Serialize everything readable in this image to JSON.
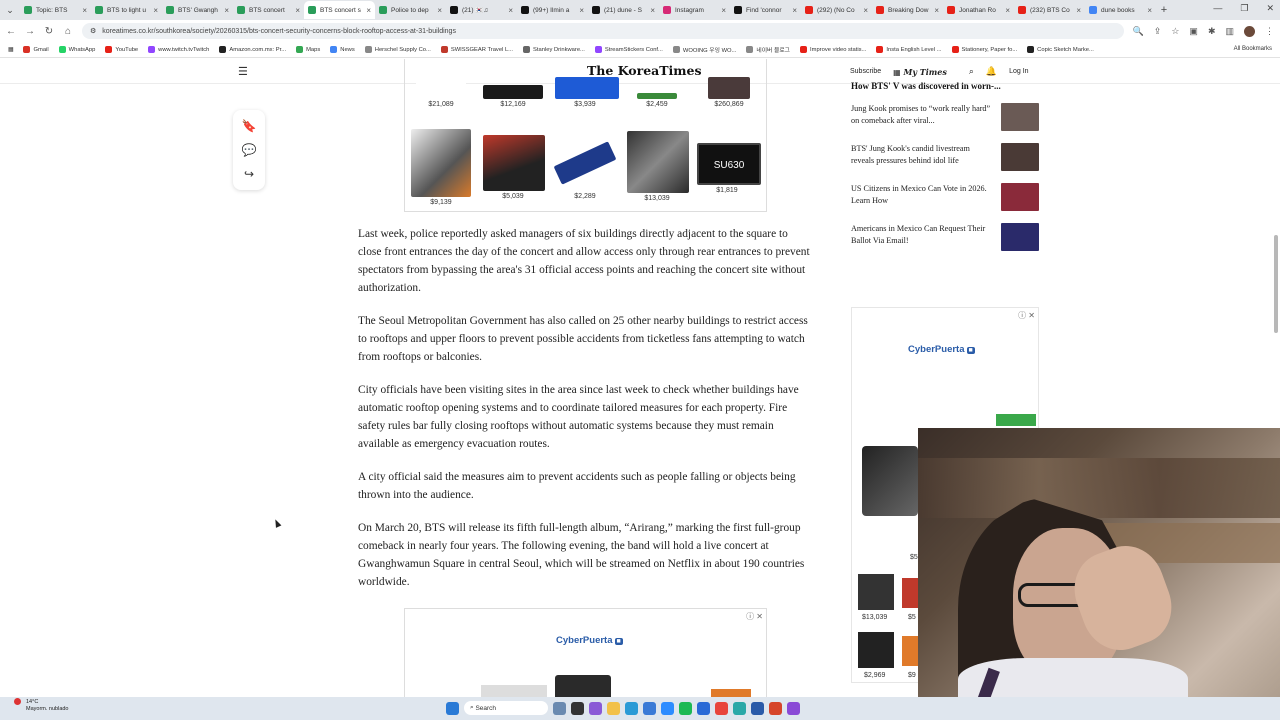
{
  "tabs": [
    {
      "label": "Topic: BTS",
      "color": "#2a9d5a",
      "active": false
    },
    {
      "label": "BTS to light u",
      "color": "#2a9d5a",
      "active": false
    },
    {
      "label": "BTS' Gwangh",
      "color": "#2a9d5a",
      "active": false
    },
    {
      "label": "BTS concert",
      "color": "#2a9d5a",
      "active": false
    },
    {
      "label": "BTS concert s",
      "color": "#2a9d5a",
      "active": true
    },
    {
      "label": "Police to dep",
      "color": "#2a9d5a",
      "active": false
    },
    {
      "label": "(21) 🇰🇷♫",
      "color": "#111111",
      "active": false
    },
    {
      "label": "(99+) Ilmin a",
      "color": "#111111",
      "active": false
    },
    {
      "label": "(21) dune - S",
      "color": "#111111",
      "active": false
    },
    {
      "label": "Instagram",
      "color": "#d62976",
      "active": false
    },
    {
      "label": "Find 'connor",
      "color": "#111111",
      "active": false
    },
    {
      "label": "(292) (No Co",
      "color": "#e62117",
      "active": false
    },
    {
      "label": "Breaking Dow",
      "color": "#e62117",
      "active": false
    },
    {
      "label": "Jonathan Ro",
      "color": "#e62117",
      "active": false
    },
    {
      "label": "(232) BTS Co",
      "color": "#e62117",
      "active": false
    },
    {
      "label": "dune books",
      "color": "#4285f4",
      "active": false
    }
  ],
  "address": {
    "url": "koreatimes.co.kr/southkorea/society/20260315/bts-concert-security-concerns-block-rooftop-access-at-31-buildings"
  },
  "bookmarks": [
    {
      "label": "Gmail",
      "color": "#d93025"
    },
    {
      "label": "WhatsApp",
      "color": "#25d366"
    },
    {
      "label": "YouTube",
      "color": "#e62117"
    },
    {
      "label": "www.twitch.tvTwitch",
      "color": "#9146ff"
    },
    {
      "label": "Amazon.com.mx: Pr...",
      "color": "#222222"
    },
    {
      "label": "Maps",
      "color": "#34a853"
    },
    {
      "label": "News",
      "color": "#4285f4"
    },
    {
      "label": "Herschel Supply Co...",
      "color": "#888888"
    },
    {
      "label": "SWISSGEAR Travel L...",
      "color": "#c0392b"
    },
    {
      "label": "Stanley Drinkware...",
      "color": "#666666"
    },
    {
      "label": "StreamStickers Conf...",
      "color": "#9146ff"
    },
    {
      "label": "WOOING 우잉 WO...",
      "color": "#888888"
    },
    {
      "label": "네이버 블로그",
      "color": "#888888"
    },
    {
      "label": "Improve video statis...",
      "color": "#e62117"
    },
    {
      "label": "Insta English Level ...",
      "color": "#e62117"
    },
    {
      "label": "Stationery, Paper fo...",
      "color": "#e62117"
    },
    {
      "label": "Copic Sketch Marke...",
      "color": "#222222"
    }
  ],
  "bookmarks_all": "All Bookmarks",
  "site": {
    "logo": "The KoreaTimes",
    "subscribe": "Subscribe",
    "mytimes": "My Times",
    "login": "Log In"
  },
  "ad_top": {
    "row1": [
      "$21,089",
      "$12,169",
      "$3,939",
      "$2,459",
      "$260,869"
    ],
    "row2": [
      "$9,139",
      "$5,039",
      "$2,289",
      "$13,039",
      "$1,819"
    ],
    "ssd_label": "SU630"
  },
  "article": {
    "paragraphs": [
      "Last week, police reportedly asked managers of six buildings directly adjacent to the square to close front entrances the day of the concert and allow access only through rear entrances to prevent spectators from bypassing the area's 31 official access points and reaching the concert site without authorization.",
      "The Seoul Metropolitan Government has also called on 25 other nearby buildings to restrict access to rooftops and upper floors to prevent possible accidents from ticketless fans attempting to watch from rooftops or balconies.",
      "City officials have been visiting sites in the area since last week to check whether buildings have automatic rooftop opening systems and to coordinate tailored measures for each property. Fire safety rules bar fully closing rooftops without automatic systems because they must remain available as emergency evacuation routes.",
      "A city official said the measures aim to prevent accidents such as people falling or objects being thrown into the audience.",
      "On March 20, BTS will release its fifth full-length album, “Arirang,” marking the first full-group comeback in nearly four years. The following evening, the band will hold a live concert at Gwanghwamun Square in central Seoul, which will be streamed on Netflix in about 190 countries worldwide."
    ]
  },
  "rail": {
    "top_headline": "How BTS' V was discovered in worn-...",
    "items": [
      {
        "title": "Jung Kook promises to “work really hard” on comeback after viral...",
        "thumb": "#6a5a55"
      },
      {
        "title": "BTS' Jung Kook's candid livestream reveals pressures behind idol life",
        "thumb": "#4a3a36"
      },
      {
        "title": "US Citizens in Mexico Can Vote in 2026. Learn How",
        "thumb": "#8a2a3a"
      },
      {
        "title": "Americans in Mexico Can Request Their Ballot Via Email!",
        "thumb": "#2a2a6a"
      }
    ],
    "ad_brand": "CyberPuerta",
    "ad_prices": [
      "$13,039",
      "$5",
      "$2,969",
      "$9"
    ],
    "ad_price_small": "$5"
  },
  "ad_bottom": {
    "brand": "CyberPuerta"
  },
  "taskbar": {
    "temp": "14°C",
    "weather": "Mayorm. nublado",
    "search": "Search"
  }
}
